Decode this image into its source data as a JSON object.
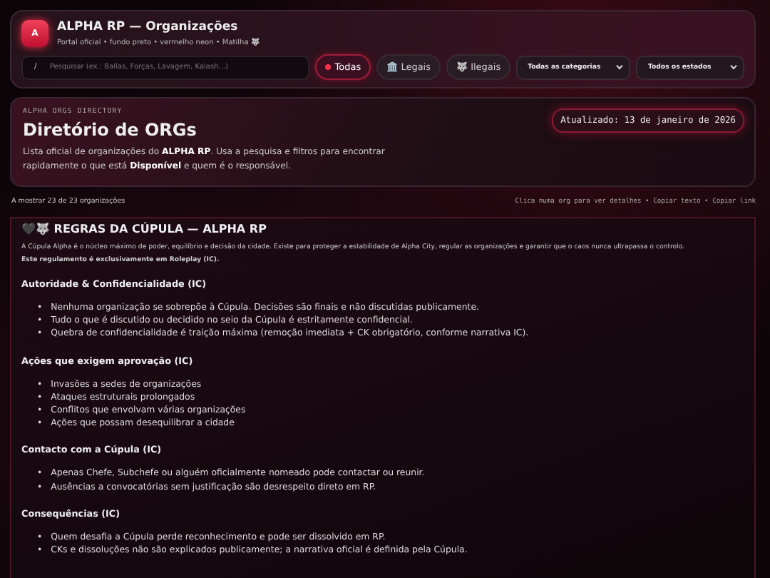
{
  "header": {
    "logo": "A",
    "title": "ALPHA RP — Organizações",
    "subtitle": "Portal oficial • fundo preto • vermelho neon • Matilha 🐺"
  },
  "search": {
    "shortcut": "/",
    "placeholder": "Pesquisar (ex.: Ballas, Forças, Lavagem, Kalash...)"
  },
  "filters": [
    {
      "label": "Todas",
      "selected": true
    },
    {
      "label": "🏛️ Legais",
      "selected": false
    },
    {
      "label": "🐺 Ilegais",
      "selected": false
    }
  ],
  "selects": [
    {
      "value": "Todas as categorias"
    },
    {
      "value": "Todos os estados"
    }
  ],
  "hero": {
    "eyebrow": "ALPHA ORGS DIRECTORY",
    "title": "Diretório de ORGs",
    "description": "Lista oficial de organizações do **ALPHA RP**. Usa a pesquisa e filtros para encontrar rapidamente o que está **Disponível** e quem é o responsável.",
    "updated": "Atualizado: 13 de janeiro de 2026"
  },
  "status": {
    "count": "A mostrar 23 de 23 organizações",
    "hint": "Clica numa org para ver detalhes • Copiar texto • Copiar link"
  },
  "rules": {
    "marker": "•",
    "title": "🖤🐺 REGRAS DA CÚPULA — ALPHA RP",
    "intro": "A Cúpula Alpha é o núcleo máximo de poder, equilíbrio e decisão da cidade. Existe para proteger a estabilidade de Alpha City, regular as organizações e garantir que o caos nunca ultrapassa o controlo.",
    "note": "Este regulamento é exclusivamente em Roleplay (IC).",
    "sections": [
      {
        "heading": "Autoridade & Confidencialidade (IC)",
        "items": [
          "Nenhuma organização se sobrepõe à Cúpula. Decisões são finais e não discutidas publicamente.",
          "Tudo o que é discutido ou decidido no seio da Cúpula é estritamente confidencial.",
          "Quebra de confidencialidade é traição máxima (remoção imediata + CK obrigatório, conforme narrativa IC)."
        ]
      },
      {
        "heading": "Ações que exigem aprovação (IC)",
        "items": [
          "Invasões a sedes de organizações",
          "Ataques estruturais prolongados",
          "Conflitos que envolvam várias organizações",
          "Ações que possam desequilibrar a cidade"
        ]
      },
      {
        "heading": "Contacto com a Cúpula (IC)",
        "items": [
          "Apenas Chefe, Subchefe ou alguém oficialmente nomeado pode contactar ou reunir.",
          "Ausências a convocatórias sem justificação são desrespeito direto em RP."
        ]
      },
      {
        "heading": "Consequências (IC)",
        "items": [
          "Quem desafia a Cúpula perde reconhecimento e pode ser dissolvido em RP.",
          "CKs e dissoluções não são explicados publicamente; a narrativa oficial é definida pela Cúpula."
        ]
      }
    ]
  }
}
